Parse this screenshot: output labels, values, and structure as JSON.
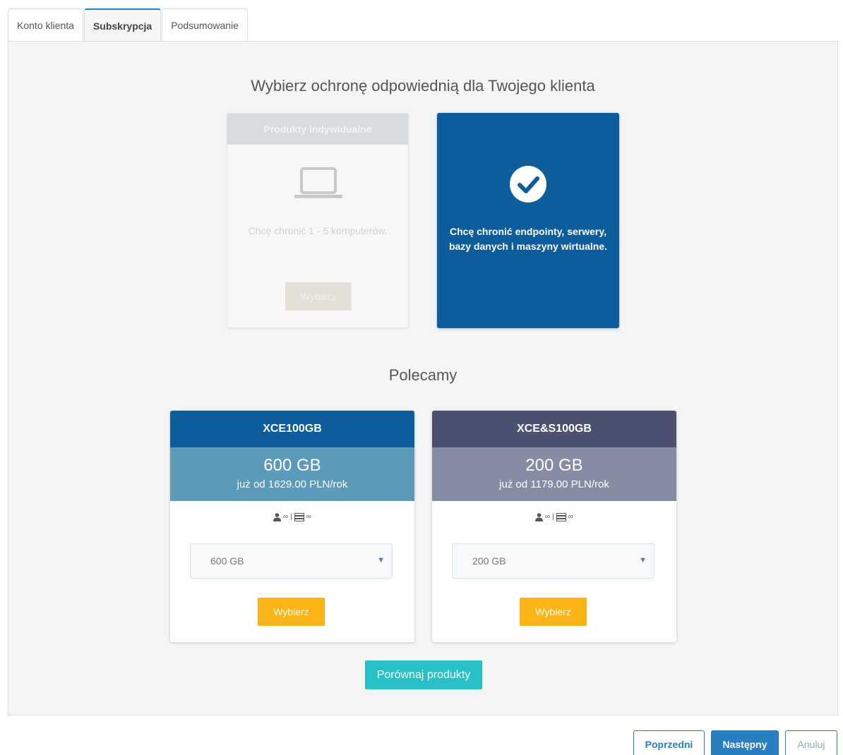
{
  "tabs": [
    {
      "label": "Konto klienta",
      "active": false
    },
    {
      "label": "Subskrypcja",
      "active": true
    },
    {
      "label": "Podsumowanie",
      "active": false
    }
  ],
  "main": {
    "heading": "Wybierz ochronę odpowiednią dla Twojego klienta",
    "individual": {
      "title": "Produkty indywidualne",
      "icon": "laptop-icon",
      "text": "Chcę chronić 1 - 5 komputerów.",
      "button": "Wybierz"
    },
    "enterprise": {
      "icon": "check-circle-icon",
      "text": "Chcę chronić endpointy, serwery, bazy danych i maszyny wirtualne.",
      "selected": true
    },
    "recommended_heading": "Polecamy",
    "products": [
      {
        "name": "XCE100GB",
        "size": "600 GB",
        "price": "już od 1629.00 PLN/rok",
        "users": "∞",
        "separator": "|",
        "servers": "∞",
        "select_value": "600 GB",
        "button": "Wybierz"
      },
      {
        "name": "XCE&S100GB",
        "size": "200 GB",
        "price": "już od 1179.00 PLN/rok",
        "users": "∞",
        "separator": "|",
        "servers": "∞",
        "select_value": "200 GB",
        "button": "Wybierz"
      }
    ],
    "compare_button": "Porównaj produkty"
  },
  "footer": {
    "prev": "Poprzedni",
    "next": "Następny",
    "cancel": "Anuluj"
  },
  "colors": {
    "primary": "#0d5d9c",
    "accent_button": "#fbb414",
    "compare_button": "#26c0c6",
    "secondary_product": "#4a5270"
  }
}
